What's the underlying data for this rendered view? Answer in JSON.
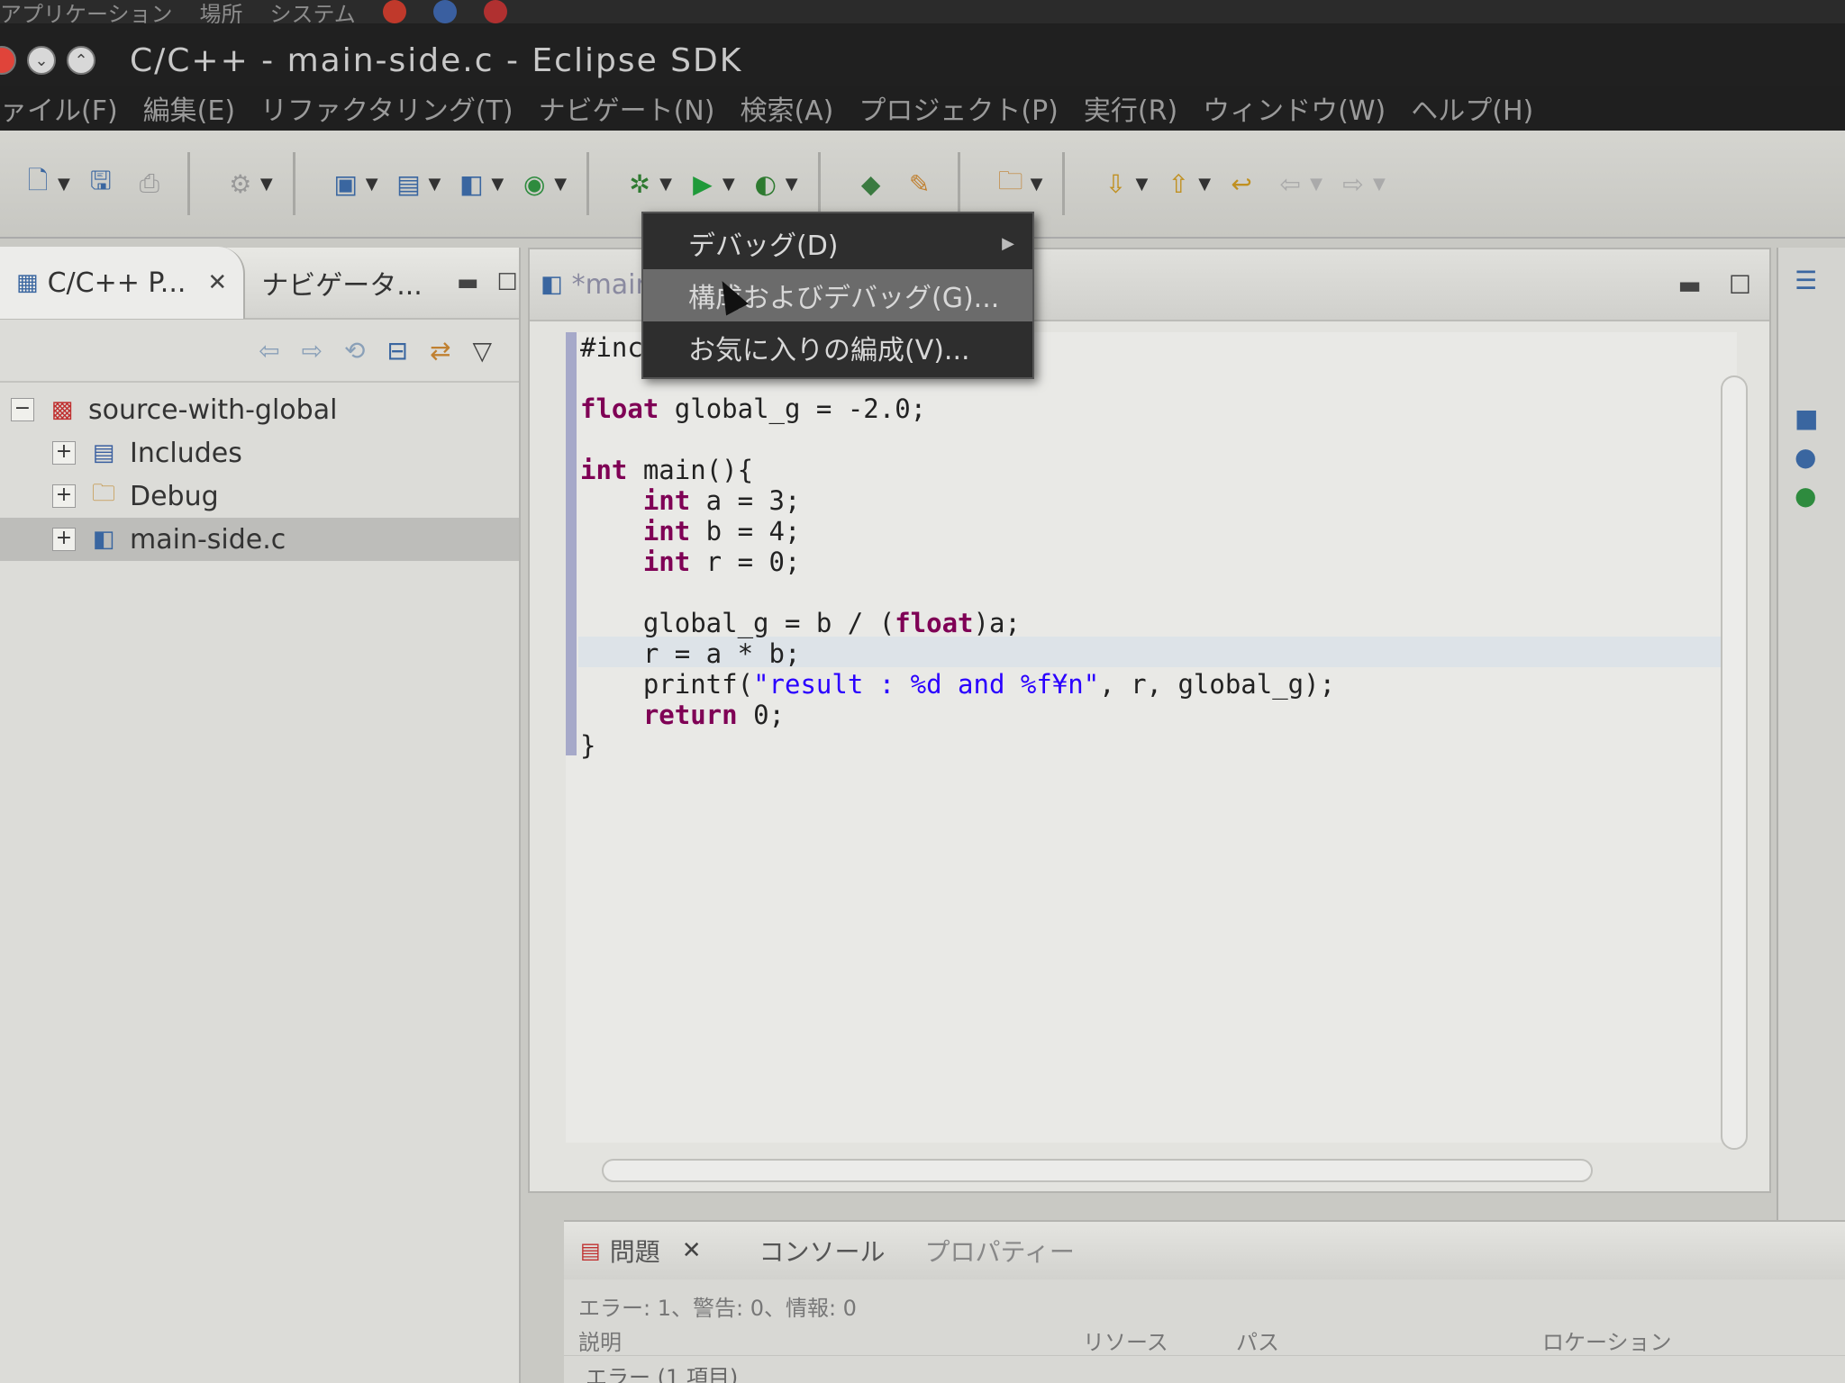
{
  "top_panel": {
    "items": [
      "アプリケーション",
      "場所",
      "システム"
    ]
  },
  "window": {
    "title": "C/C++ - main-side.c - Eclipse SDK"
  },
  "menu": {
    "items": [
      "ァイル(F)",
      "編集(E)",
      "リファクタリング(T)",
      "ナビゲート(N)",
      "検索(A)",
      "プロジェクト(P)",
      "実行(R)",
      "ウィンドウ(W)",
      "ヘルプ(H)"
    ]
  },
  "explorer": {
    "tab_active": "C/C++ P...",
    "tab_other": "ナビゲータ...",
    "tree": [
      {
        "expander": "−",
        "icon": "project-icon",
        "label": "source-with-global"
      },
      {
        "expander": "+",
        "icon": "includes-icon",
        "label": "Includes"
      },
      {
        "expander": "+",
        "icon": "folder-icon",
        "label": "Debug"
      },
      {
        "expander": "+",
        "icon": "c-file-icon",
        "label": "main-side.c"
      }
    ]
  },
  "editor": {
    "tab_label": "*main",
    "code": {
      "l1": "#inc",
      "l3a": "float",
      "l3b": " global_g = -2.0;",
      "l5a": "int",
      "l5b": " main(){",
      "l6a": "    int",
      "l6b": " a = 3;",
      "l7a": "    int",
      "l7b": " b = 4;",
      "l8a": "    int",
      "l8b": " r = 0;",
      "l10a": "    global_g = b / (",
      "l10b": "float",
      "l10c": ")a;",
      "l11": "    r = a * b;",
      "l12a": "    printf(",
      "l12b": "\"result : %d and %f¥n\"",
      "l12c": ", r, global_g);",
      "l13a": "    return",
      "l13b": " 0;",
      "l14": "}"
    }
  },
  "popup_menu": {
    "items": [
      "デバッグ(D)",
      "構成およびデバッグ(G)...",
      "お気に入りの編成(V)..."
    ],
    "hover_index": 1
  },
  "problems": {
    "tabs": [
      "問題",
      "コンソール",
      "プロパティー"
    ],
    "summary": "エラー: 1、警告: 0、情報: 0",
    "columns": [
      "説明",
      "リソース",
      "パス",
      "ロケーション"
    ],
    "first_row": "エラー (1 項目)"
  },
  "colors": {
    "keyword": "#7f0055",
    "string": "#2a00ff",
    "menu_bg": "#2e2e2e"
  }
}
